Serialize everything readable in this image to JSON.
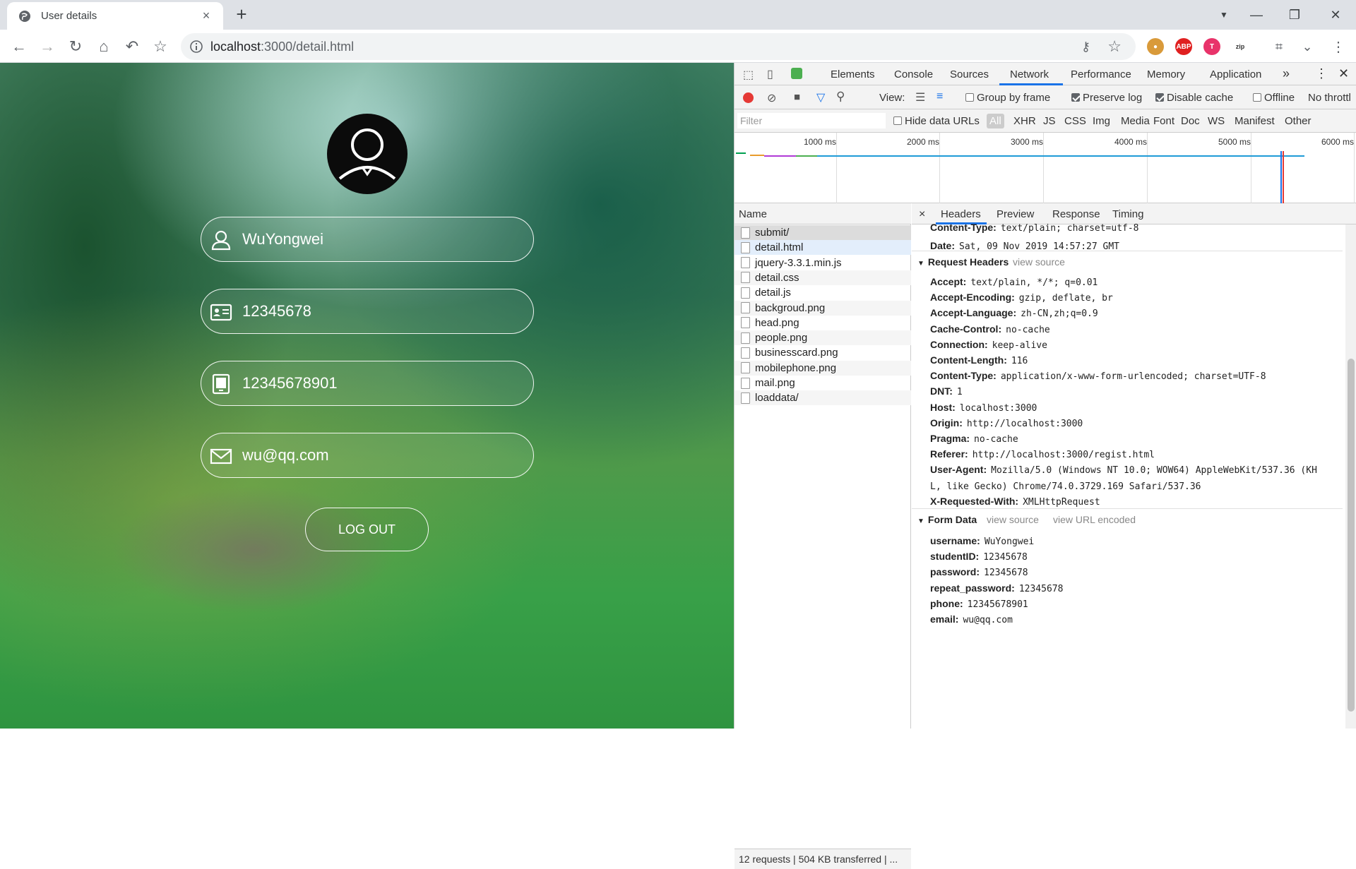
{
  "browser": {
    "tab_title": "User details",
    "url_host": "localhost",
    "url_rest": ":3000/detail.html",
    "new_tab": "+",
    "tab_close": "×"
  },
  "user": {
    "username": "WuYongwei",
    "student_id": "12345678",
    "phone": "12345678901",
    "email": "wu@qq.com",
    "logout_label": "LOG OUT"
  },
  "devtools": {
    "tabs": [
      "Elements",
      "Console",
      "Sources",
      "Network",
      "Performance",
      "Memory",
      "Application"
    ],
    "more": "»",
    "toolbar": {
      "view_label": "View:",
      "group_by_frame": "Group by frame",
      "preserve_log": "Preserve log",
      "disable_cache": "Disable cache",
      "offline": "Offline",
      "throttle": "No throttl"
    },
    "filter": {
      "placeholder": "Filter",
      "hide_data_urls": "Hide data URLs",
      "types": [
        "All",
        "XHR",
        "JS",
        "CSS",
        "Img",
        "Media",
        "Font",
        "Doc",
        "WS",
        "Manifest",
        "Other"
      ]
    },
    "timeline_labels": [
      "1000 ms",
      "2000 ms",
      "3000 ms",
      "4000 ms",
      "5000 ms",
      "6000 ms"
    ],
    "name_header": "Name",
    "requests": [
      "submit/",
      "detail.html",
      "jquery-3.3.1.min.js",
      "detail.css",
      "detail.js",
      "backgroud.png",
      "head.png",
      "people.png",
      "businesscard.png",
      "mobilephone.png",
      "mail.png",
      "loaddata/"
    ],
    "status": "12 requests | 504 KB transferred | ...",
    "detail_tabs": [
      "Headers",
      "Preview",
      "Response",
      "Timing"
    ],
    "detail_close": "×",
    "response_headers_partial": [
      {
        "k": "Content-Type:",
        "v": "text/plain; charset=utf-8"
      },
      {
        "k": "Date:",
        "v": "Sat, 09 Nov 2019 14:57:27 GMT"
      }
    ],
    "request_headers_title": "Request Headers",
    "view_source": "view source",
    "request_headers": [
      {
        "k": "Accept:",
        "v": "text/plain, */*; q=0.01"
      },
      {
        "k": "Accept-Encoding:",
        "v": "gzip, deflate, br"
      },
      {
        "k": "Accept-Language:",
        "v": "zh-CN,zh;q=0.9"
      },
      {
        "k": "Cache-Control:",
        "v": "no-cache"
      },
      {
        "k": "Connection:",
        "v": "keep-alive"
      },
      {
        "k": "Content-Length:",
        "v": "116"
      },
      {
        "k": "Content-Type:",
        "v": "application/x-www-form-urlencoded; charset=UTF-8"
      },
      {
        "k": "DNT:",
        "v": "1"
      },
      {
        "k": "Host:",
        "v": "localhost:3000"
      },
      {
        "k": "Origin:",
        "v": "http://localhost:3000"
      },
      {
        "k": "Pragma:",
        "v": "no-cache"
      },
      {
        "k": "Referer:",
        "v": "http://localhost:3000/regist.html"
      },
      {
        "k": "User-Agent:",
        "v": "Mozilla/5.0 (Windows NT 10.0; WOW64) AppleWebKit/537.36 (KH"
      },
      {
        "k": "",
        "v": "L, like Gecko) Chrome/74.0.3729.169 Safari/537.36"
      },
      {
        "k": "X-Requested-With:",
        "v": "XMLHttpRequest"
      }
    ],
    "form_data_title": "Form Data",
    "view_url_encoded": "view URL encoded",
    "form_data": [
      {
        "k": "username:",
        "v": "WuYongwei"
      },
      {
        "k": "studentID:",
        "v": "12345678"
      },
      {
        "k": "password:",
        "v": "12345678"
      },
      {
        "k": "repeat_password:",
        "v": "12345678"
      },
      {
        "k": "phone:",
        "v": "12345678901"
      },
      {
        "k": "email:",
        "v": "wu@qq.com"
      }
    ]
  }
}
